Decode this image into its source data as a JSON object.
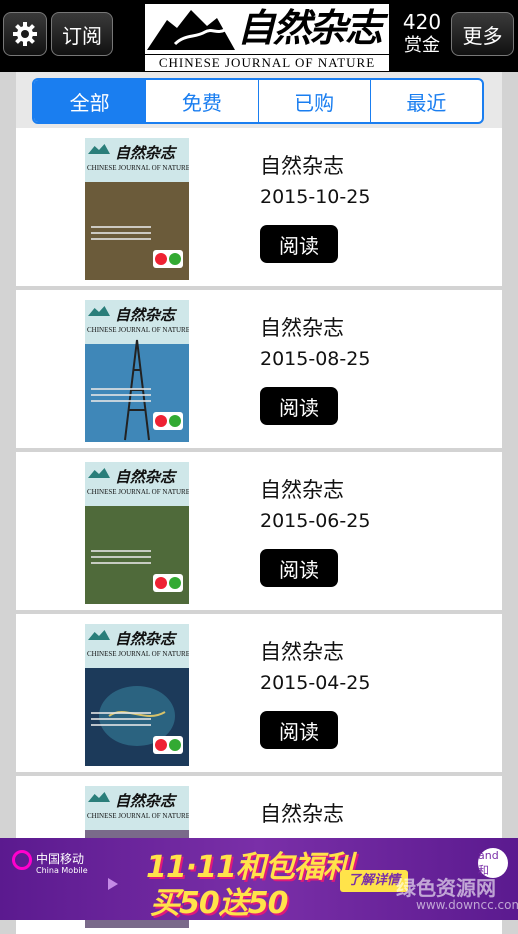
{
  "header": {
    "settings_icon": "gear-icon",
    "subscribe_label": "订阅",
    "logo_cn": "自然杂志",
    "logo_en": "CHINESE JOURNAL OF NATURE",
    "reward_count": "420",
    "reward_label": "赏金",
    "more_label": "更多"
  },
  "tabs": [
    {
      "label": "全部",
      "active": true
    },
    {
      "label": "免费",
      "active": false
    },
    {
      "label": "已购",
      "active": false
    },
    {
      "label": "最近",
      "active": false
    }
  ],
  "issues": [
    {
      "title": "自然杂志",
      "date": "2015-10-25",
      "read_label": "阅读",
      "cover_color": "#6b5b3a"
    },
    {
      "title": "自然杂志",
      "date": "2015-08-25",
      "read_label": "阅读",
      "cover_color": "#3f87b8"
    },
    {
      "title": "自然杂志",
      "date": "2015-06-25",
      "read_label": "阅读",
      "cover_color": "#4f6a3a"
    },
    {
      "title": "自然杂志",
      "date": "2015-04-25",
      "read_label": "阅读",
      "cover_color": "#1c3a5a"
    },
    {
      "title": "自然杂志",
      "date": "",
      "read_label": "",
      "cover_color": "#7a6a8a"
    }
  ],
  "cover": {
    "title": "自然杂志",
    "subtitle": "CHINESE JOURNAL OF NATURE"
  },
  "banner": {
    "carrier_cn": "中国移动",
    "carrier_en": "China Mobile",
    "promo_line1": "11·11和包福利",
    "promo_line2": "买50送50",
    "promo_more": "了解详情",
    "badge_text": "and和",
    "watermark": "绿色资源网",
    "watermark_url": "www.downcc.com"
  },
  "colors": {
    "accent": "#1a7ef0",
    "header_bg": "#000000",
    "banner_bg": "#6a2399"
  }
}
